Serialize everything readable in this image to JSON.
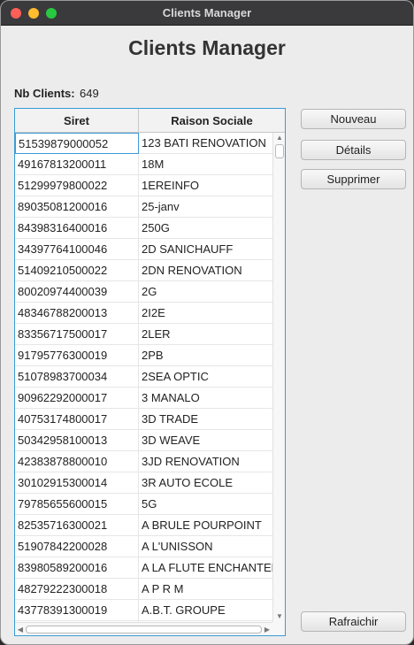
{
  "window": {
    "title": "Clients Manager"
  },
  "heading": "Clients Manager",
  "stats": {
    "count_label": "Nb Clients:",
    "count_value": "649"
  },
  "table": {
    "columns": [
      "Siret",
      "Raison Sociale"
    ],
    "rows": [
      [
        "51539879000052",
        "123 BATI RENOVATION"
      ],
      [
        "49167813200011",
        "18M"
      ],
      [
        "51299979800022",
        "1EREINFO"
      ],
      [
        "89035081200016",
        "25-janv"
      ],
      [
        "84398316400016",
        "250G"
      ],
      [
        "34397764100046",
        "2D SANICHAUFF"
      ],
      [
        "51409210500022",
        "2DN RENOVATION"
      ],
      [
        "80020974400039",
        "2G"
      ],
      [
        "48346788200013",
        "2I2E"
      ],
      [
        "83356717500017",
        "2LER"
      ],
      [
        "91795776300019",
        "2PB"
      ],
      [
        "51078983700034",
        "2SEA OPTIC"
      ],
      [
        "90962292000017",
        "3 MANALO"
      ],
      [
        "40753174800017",
        "3D TRADE"
      ],
      [
        "50342958100013",
        "3D WEAVE"
      ],
      [
        "42383878800010",
        "3JD RENOVATION"
      ],
      [
        "30102915300014",
        "3R AUTO ECOLE"
      ],
      [
        "79785655600015",
        "5G"
      ],
      [
        "82535716300021",
        "A BRULE POURPOINT"
      ],
      [
        "51907842200028",
        "A L'UNISSON"
      ],
      [
        "83980589200016",
        "A LA FLUTE ENCHANTEE"
      ],
      [
        "48279222300018",
        "A P R M"
      ],
      [
        "43778391300019",
        "A.B.T. GROUPE"
      ],
      [
        "",
        ""
      ]
    ]
  },
  "buttons": {
    "new": "Nouveau",
    "details": "Détails",
    "delete": "Supprimer",
    "refresh": "Rafraichir"
  }
}
